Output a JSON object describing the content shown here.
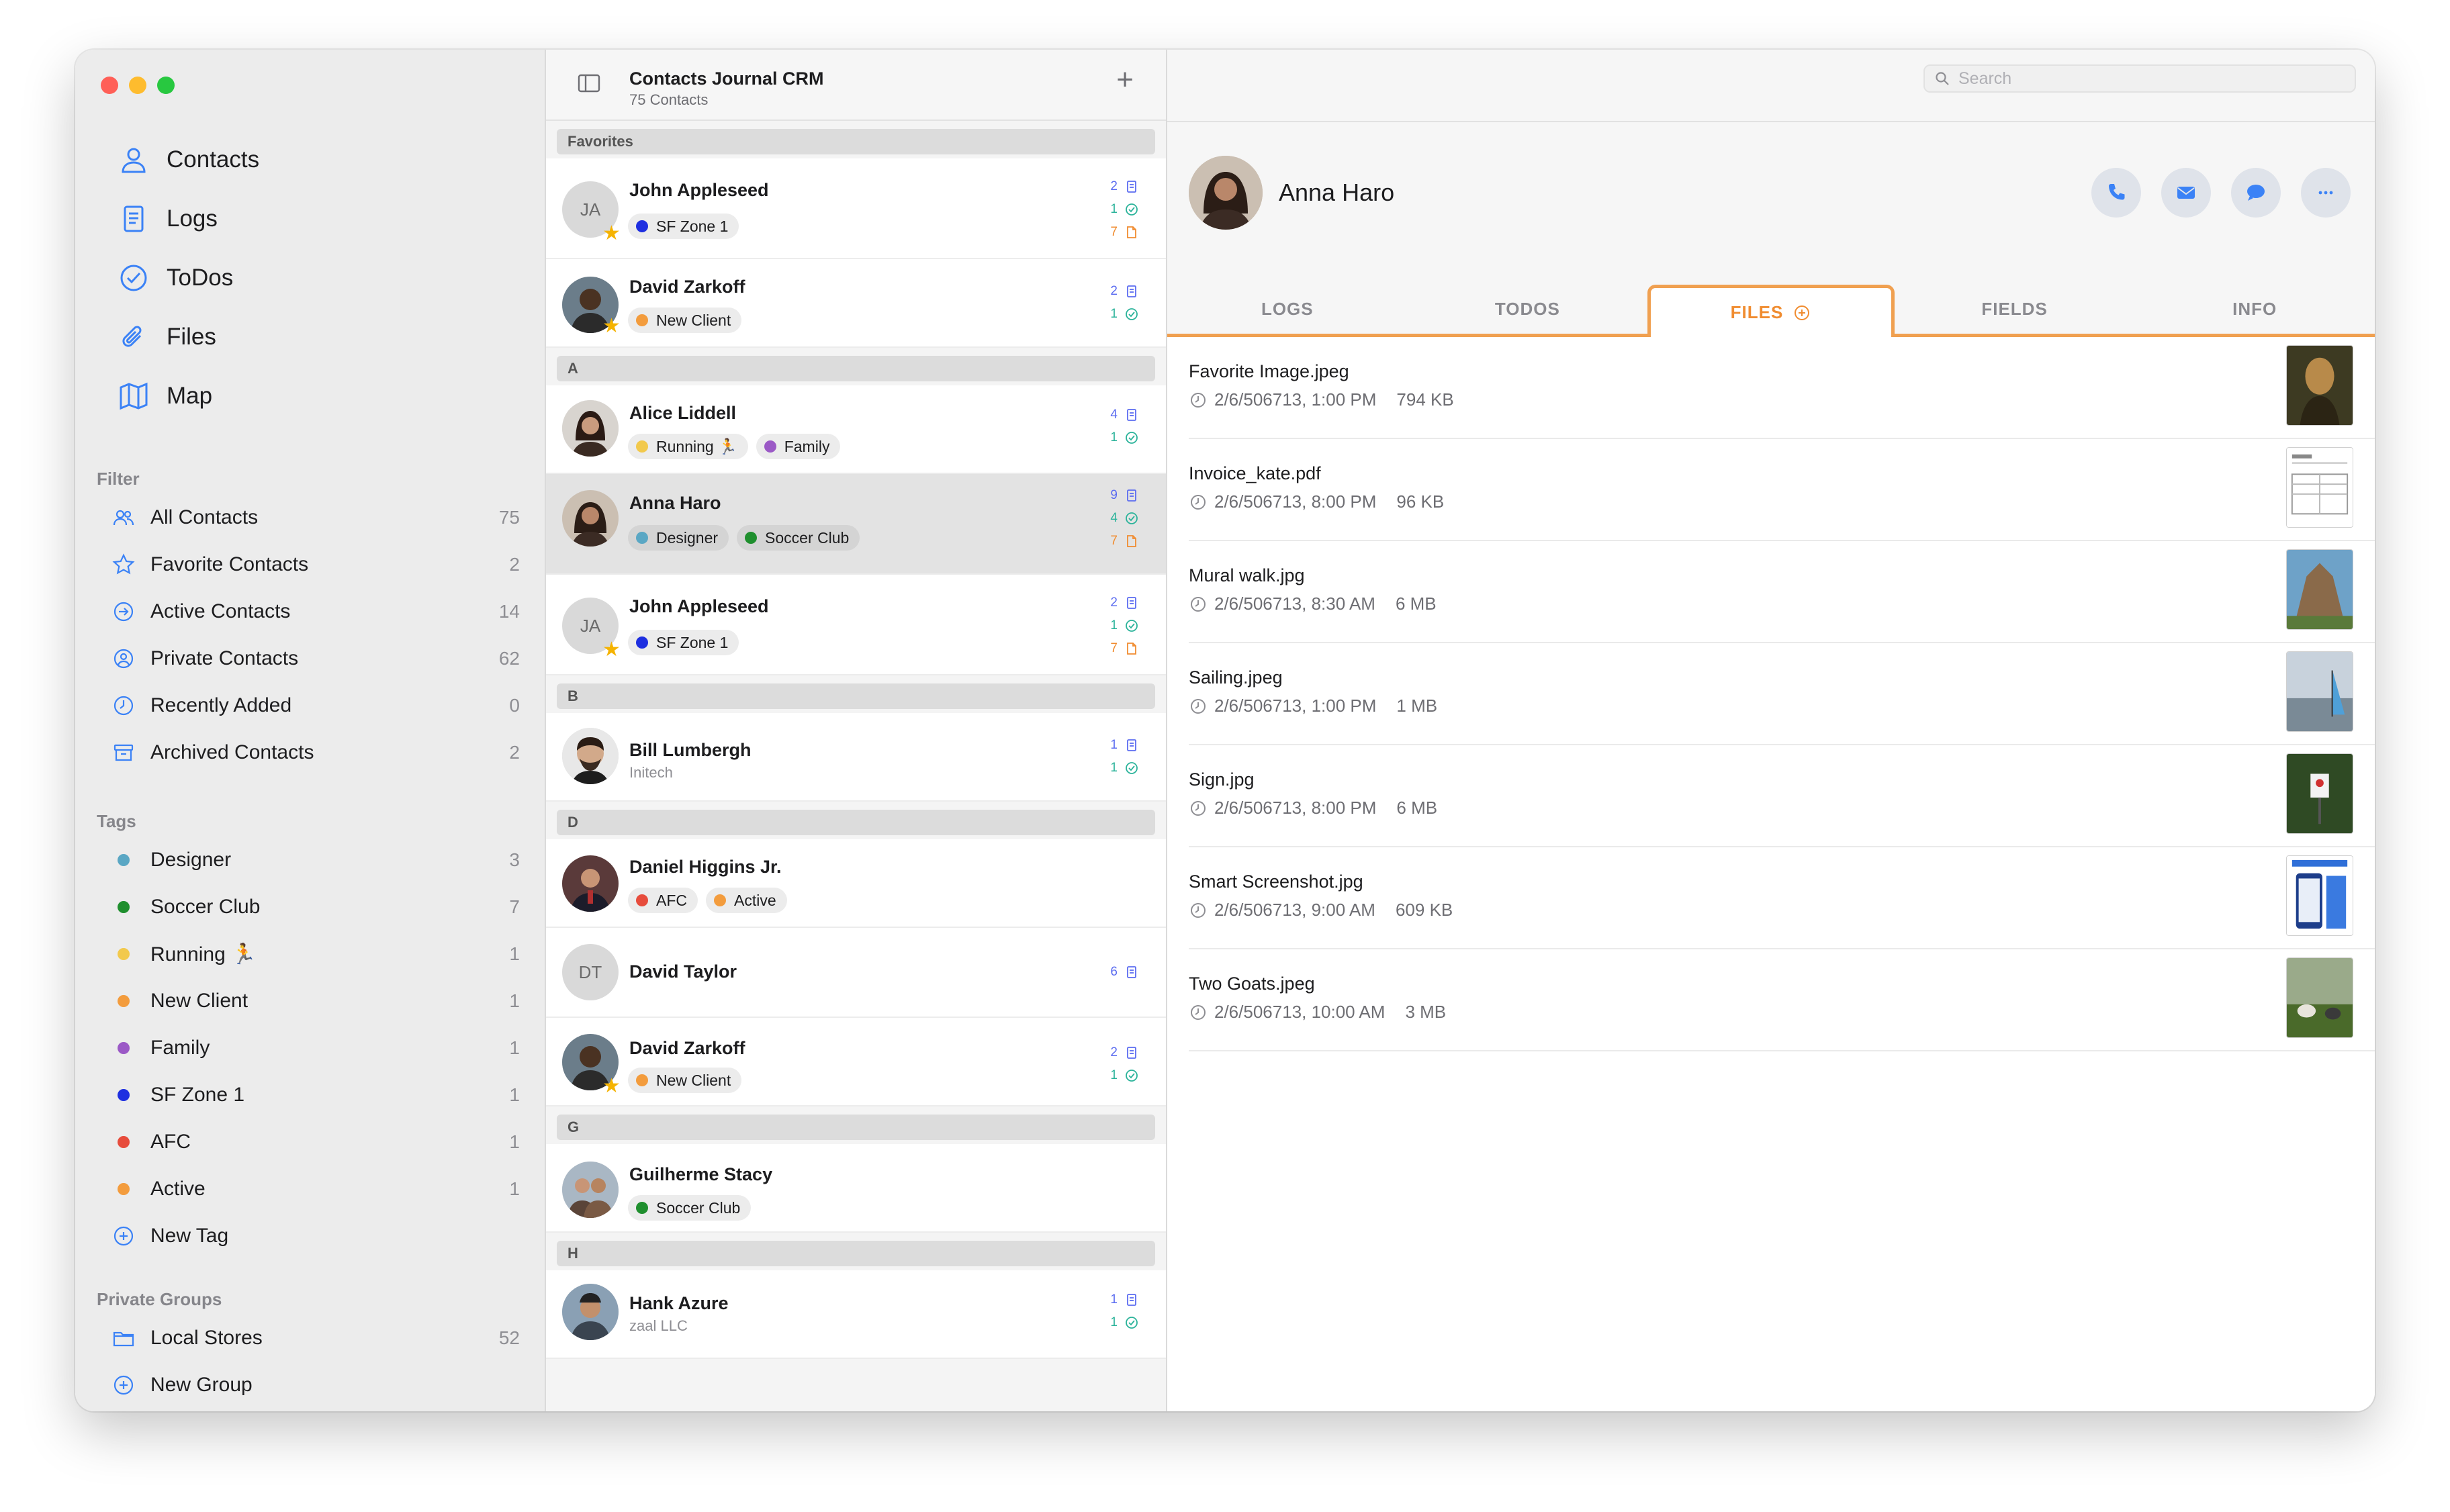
{
  "sidebar": {
    "nav": [
      {
        "label": "Contacts",
        "icon": "person-icon"
      },
      {
        "label": "Logs",
        "icon": "document-icon"
      },
      {
        "label": "ToDos",
        "icon": "checkmark-circle-icon"
      },
      {
        "label": "Files",
        "icon": "paperclip-icon"
      },
      {
        "label": "Map",
        "icon": "map-icon"
      }
    ],
    "filter_title": "Filter",
    "filters": [
      {
        "label": "All Contacts",
        "count": "75",
        "icon": "people-icon"
      },
      {
        "label": "Favorite Contacts",
        "count": "2",
        "icon": "star-icon"
      },
      {
        "label": "Active Contacts",
        "count": "14",
        "icon": "arrow-circle-icon"
      },
      {
        "label": "Private Contacts",
        "count": "62",
        "icon": "person-circle-icon"
      },
      {
        "label": "Recently Added",
        "count": "0",
        "icon": "clock-icon"
      },
      {
        "label": "Archived Contacts",
        "count": "2",
        "icon": "archive-box-icon"
      }
    ],
    "tags_title": "Tags",
    "tags": [
      {
        "label": "Designer",
        "count": "3",
        "color": "#5aa7c4"
      },
      {
        "label": "Soccer Club",
        "count": "7",
        "color": "#1f8f2e"
      },
      {
        "label": "Running 🏃",
        "count": "1",
        "color": "#f2c94c"
      },
      {
        "label": "New Client",
        "count": "1",
        "color": "#f39c3d"
      },
      {
        "label": "Family",
        "count": "1",
        "color": "#9b59c6"
      },
      {
        "label": "SF Zone 1",
        "count": "1",
        "color": "#1e2fe0"
      },
      {
        "label": "AFC",
        "count": "1",
        "color": "#e74c3c"
      },
      {
        "label": "Active",
        "count": "1",
        "color": "#f39c3d"
      }
    ],
    "new_tag": "New Tag",
    "groups_title": "Private Groups",
    "groups": [
      {
        "label": "Local Stores",
        "count": "52"
      }
    ],
    "new_group": "New Group"
  },
  "middle": {
    "title": "Contacts Journal CRM",
    "subtitle": "75 Contacts",
    "sections": {
      "favorites": "Favorites",
      "a": "A",
      "b": "B",
      "d": "D",
      "g": "G",
      "h": "H"
    },
    "contacts": [
      {
        "name": "John Appleseed",
        "initials": "JA",
        "tags": [
          {
            "label": "SF Zone 1",
            "color": "#1e2fe0"
          }
        ],
        "logs": "2",
        "todos": "1",
        "files": "7"
      },
      {
        "name": "David Zarkoff",
        "tags": [
          {
            "label": "New Client",
            "color": "#f39c3d"
          }
        ],
        "logs": "2",
        "todos": "1"
      },
      {
        "name": "Alice Liddell",
        "tags": [
          {
            "label": "Running 🏃",
            "color": "#f2c94c"
          },
          {
            "label": "Family",
            "color": "#9b59c6"
          }
        ],
        "logs": "4",
        "todos": "1"
      },
      {
        "name": "Anna Haro",
        "tags": [
          {
            "label": "Designer",
            "color": "#5aa7c4"
          },
          {
            "label": "Soccer Club",
            "color": "#1f8f2e"
          }
        ],
        "logs": "9",
        "todos": "4",
        "files": "7"
      },
      {
        "name": "John Appleseed",
        "initials": "JA",
        "tags": [
          {
            "label": "SF Zone 1",
            "color": "#1e2fe0"
          }
        ],
        "logs": "2",
        "todos": "1",
        "files": "7"
      },
      {
        "name": "Bill Lumbergh",
        "company": "Initech",
        "logs": "1",
        "todos": "1"
      },
      {
        "name": "Daniel Higgins Jr.",
        "tags": [
          {
            "label": "AFC",
            "color": "#e74c3c"
          },
          {
            "label": "Active",
            "color": "#f39c3d"
          }
        ]
      },
      {
        "name": "David Taylor",
        "initials": "DT",
        "logs": "6"
      },
      {
        "name": "David Zarkoff",
        "tags": [
          {
            "label": "New Client",
            "color": "#f39c3d"
          }
        ],
        "logs": "2",
        "todos": "1"
      },
      {
        "name": "Guilherme Stacy",
        "tags": [
          {
            "label": "Soccer Club",
            "color": "#1f8f2e"
          }
        ]
      },
      {
        "name": "Hank Azure",
        "company": "zaal LLC",
        "logs": "1",
        "todos": "1"
      }
    ]
  },
  "detail": {
    "search_placeholder": "Search",
    "name": "Anna Haro",
    "tabs": [
      "LOGS",
      "TODOS",
      "FILES",
      "FIELDS",
      "INFO"
    ],
    "active_tab": "FILES",
    "files": [
      {
        "name": "Favorite Image.jpeg",
        "date": "2/6/506713, 1:00 PM",
        "size": "794 KB"
      },
      {
        "name": "Invoice_kate.pdf",
        "date": "2/6/506713, 8:00 PM",
        "size": "96 KB"
      },
      {
        "name": "Mural walk.jpg",
        "date": "2/6/506713, 8:30 AM",
        "size": "6 MB"
      },
      {
        "name": "Sailing.jpeg",
        "date": "2/6/506713, 1:00 PM",
        "size": "1 MB"
      },
      {
        "name": "Sign.jpg",
        "date": "2/6/506713, 8:00 PM",
        "size": "6 MB"
      },
      {
        "name": "Smart Screenshot.jpg",
        "date": "2/6/506713, 9:00 AM",
        "size": "609 KB"
      },
      {
        "name": "Two Goats.jpeg",
        "date": "2/6/506713, 10:00 AM",
        "size": "3 MB"
      }
    ]
  },
  "colors": {
    "accent": "#f08c30",
    "icon_blue": "#3b82f6",
    "logs_color": "#5b6cf0",
    "todos_color": "#2bb39a",
    "files_color": "#f08c30"
  }
}
